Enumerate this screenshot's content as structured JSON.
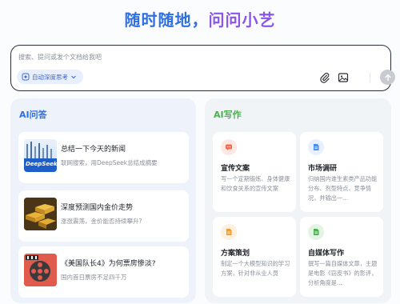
{
  "headline": {
    "part1": "随时随地，",
    "part2": "问问小艺"
  },
  "input": {
    "placeholder": "搜索、提问或发个文档给我吧",
    "deep_think_label": "自动深度思考",
    "attach_icon": "paperclip-icon",
    "image_icon": "image-icon",
    "send_icon": "arrow-up-icon"
  },
  "qa": {
    "title": "AI问答",
    "cards": [
      {
        "title": "总结一下今天的新闻",
        "sub": "联网搜索，用DeepSeek总结成摘要",
        "thumb_text": "DeepSeek"
      },
      {
        "title": "深度预测国内金价走势",
        "sub": "涨涨震荡，金价能否持续攀升?"
      },
      {
        "title": "《美国队长4》为何票房惨淡?",
        "sub": "国内首日票房不足四千万"
      }
    ]
  },
  "write": {
    "title": "AI写作",
    "cards": [
      {
        "title": "宣传文案",
        "desc": "写一个定期锻炼、身体健康和饮食关系的宣传文案",
        "icon": "chat-icon",
        "color": "#f26b4f"
      },
      {
        "title": "市场调研",
        "desc": "归纳国内谁生素类产品功能分布、剂型特点、竞争情况，并输出一...",
        "icon": "doc-icon",
        "color": "#4a8df2"
      },
      {
        "title": "方案策划",
        "desc": "制定一个大模型知识的学习方案，针对非从业人员",
        "icon": "doc-icon",
        "color": "#f39a2c"
      },
      {
        "title": "自媒体写作",
        "desc": "撰写一篇自媒体文章，主题是电影《窃皮书》的影评，分析角度是...",
        "icon": "doc-icon",
        "color": "#4caf50"
      }
    ]
  },
  "colors": {
    "accent": "#2f6fe4",
    "green": "#4caf50"
  }
}
